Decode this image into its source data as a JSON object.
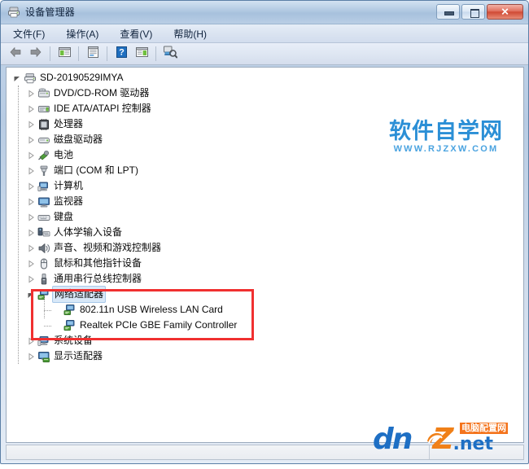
{
  "window": {
    "title": "设备管理器",
    "icon": "device-manager-icon",
    "buttons": {
      "minimize": "最小化",
      "maximize": "最大化",
      "close": "关闭"
    }
  },
  "menubar": {
    "items": [
      {
        "label": "文件(F)",
        "name": "menu-file"
      },
      {
        "label": "操作(A)",
        "name": "menu-action"
      },
      {
        "label": "查看(V)",
        "name": "menu-view"
      },
      {
        "label": "帮助(H)",
        "name": "menu-help"
      }
    ]
  },
  "toolbar": {
    "buttons": [
      {
        "name": "back-button",
        "icon": "arrow-left-icon"
      },
      {
        "name": "forward-button",
        "icon": "arrow-right-icon"
      },
      {
        "name": "show-hide-console-tree-button",
        "icon": "console-tree-icon"
      },
      {
        "name": "properties-button",
        "icon": "properties-icon"
      },
      {
        "name": "help-button",
        "icon": "question-mark-icon"
      },
      {
        "name": "show-hide-action-pane-button",
        "icon": "action-pane-icon"
      },
      {
        "name": "scan-for-hardware-changes-button",
        "icon": "scan-hardware-icon"
      }
    ]
  },
  "tree": {
    "nodes": [
      {
        "label": "SD-20190529IMYA",
        "level": 0,
        "state": "expanded",
        "icon": "computer-root-icon",
        "selected": false
      },
      {
        "label": "DVD/CD-ROM 驱动器",
        "level": 1,
        "state": "collapsed",
        "icon": "dvd-drive-icon",
        "selected": false
      },
      {
        "label": "IDE ATA/ATAPI 控制器",
        "level": 1,
        "state": "collapsed",
        "icon": "ide-controller-icon",
        "selected": false
      },
      {
        "label": "处理器",
        "level": 1,
        "state": "collapsed",
        "icon": "processor-icon",
        "selected": false
      },
      {
        "label": "磁盘驱动器",
        "level": 1,
        "state": "collapsed",
        "icon": "disk-drive-icon",
        "selected": false
      },
      {
        "label": "电池",
        "level": 1,
        "state": "collapsed",
        "icon": "battery-icon",
        "selected": false
      },
      {
        "label": "端口 (COM 和 LPT)",
        "level": 1,
        "state": "collapsed",
        "icon": "port-icon",
        "selected": false
      },
      {
        "label": "计算机",
        "level": 1,
        "state": "collapsed",
        "icon": "computer-icon",
        "selected": false
      },
      {
        "label": "监视器",
        "level": 1,
        "state": "collapsed",
        "icon": "monitor-icon",
        "selected": false
      },
      {
        "label": "键盘",
        "level": 1,
        "state": "collapsed",
        "icon": "keyboard-icon",
        "selected": false
      },
      {
        "label": "人体学输入设备",
        "level": 1,
        "state": "collapsed",
        "icon": "hid-icon",
        "selected": false
      },
      {
        "label": "声音、视频和游戏控制器",
        "level": 1,
        "state": "collapsed",
        "icon": "sound-video-game-icon",
        "selected": false
      },
      {
        "label": "鼠标和其他指针设备",
        "level": 1,
        "state": "collapsed",
        "icon": "mouse-icon",
        "selected": false
      },
      {
        "label": "通用串行总线控制器",
        "level": 1,
        "state": "collapsed",
        "icon": "usb-controller-icon",
        "selected": false
      },
      {
        "label": "网络适配器",
        "level": 1,
        "state": "expanded",
        "icon": "network-adapter-icon",
        "selected": true
      },
      {
        "label": "802.11n USB Wireless LAN Card",
        "level": 2,
        "state": "leaf",
        "icon": "network-adapter-icon",
        "selected": false
      },
      {
        "label": "Realtek PCIe GBE Family Controller",
        "level": 2,
        "state": "leaf",
        "icon": "network-adapter-icon",
        "selected": false
      },
      {
        "label": "系统设备",
        "level": 1,
        "state": "collapsed",
        "icon": "system-device-icon",
        "selected": false
      },
      {
        "label": "显示适配器",
        "level": 1,
        "state": "collapsed",
        "icon": "display-adapter-icon",
        "selected": false
      }
    ]
  },
  "annotation": {
    "highlight_color": "#f03030",
    "name": "network-adapters-highlight"
  },
  "statusbar": {
    "text": ""
  },
  "watermarks": {
    "rjzxw": {
      "cn": "软件自学网",
      "en": "WWW.RJZXW.COM",
      "color": "#2b8fd6"
    },
    "dnpz": {
      "dn": "dn",
      "pz": "Z",
      "net": ".net",
      "badge": "电脑配置网",
      "blue": "#1e6fc4",
      "orange": "#f08018"
    }
  }
}
